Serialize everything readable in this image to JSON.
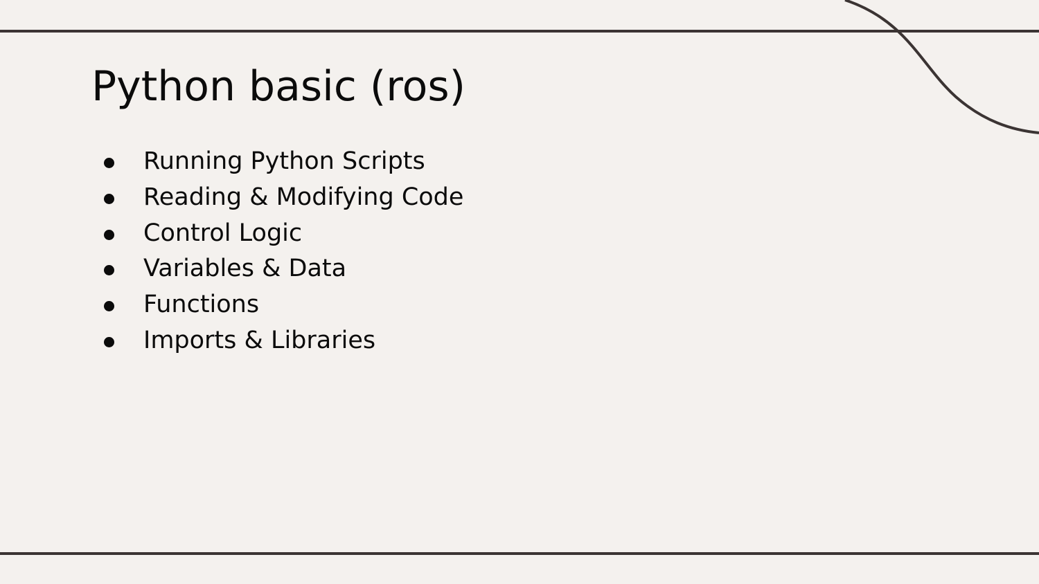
{
  "slide": {
    "title": "Python basic (ros)",
    "bullets": [
      "Running Python Scripts",
      "Reading & Modifying Code",
      "Control Logic",
      "Variables & Data",
      "Functions",
      "Imports & Libraries"
    ]
  },
  "colors": {
    "background": "#f4f1ee",
    "rule": "#3b3433",
    "text": "#0b0b0b"
  }
}
